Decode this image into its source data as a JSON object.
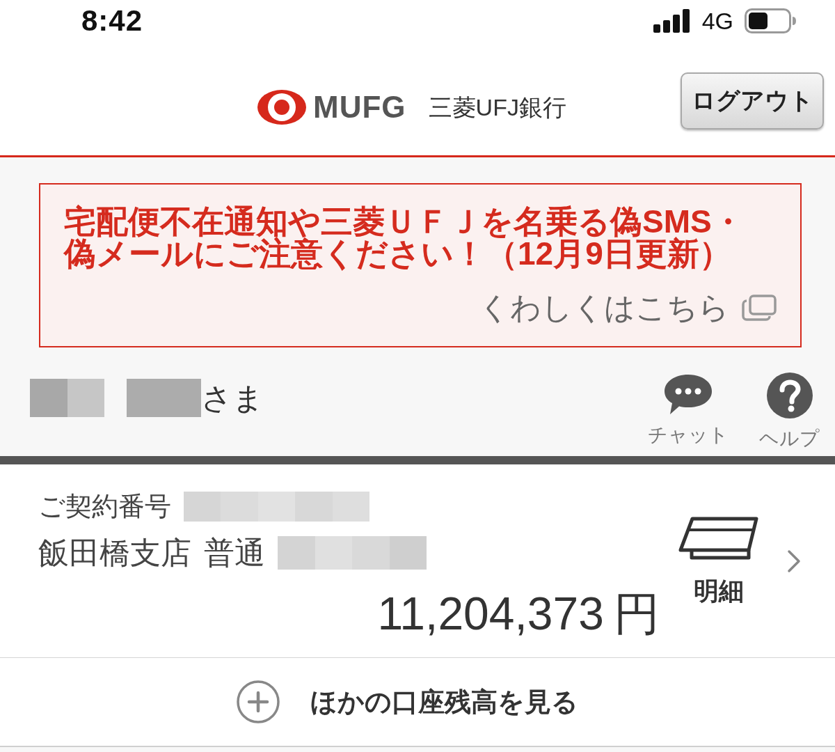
{
  "status_bar": {
    "time": "8:42",
    "network": "4G"
  },
  "header": {
    "logo_text": "MUFG",
    "bank_name": "三菱UFJ銀行",
    "logout_button": "ログアウト"
  },
  "alert": {
    "message": "宅配便不在通知や三菱ＵＦＪを名乗る偽SMS・偽メールにご注意ください！（12月9日更新）",
    "link": "くわしくはこちら"
  },
  "user": {
    "suffix": "さま"
  },
  "quick_actions": [
    {
      "kind": "chat",
      "label": "チャット"
    },
    {
      "kind": "help",
      "label": "ヘルプ"
    }
  ],
  "account": {
    "contract_label": "ご契約番号",
    "branch": "飯田橋支店",
    "type": "普通",
    "balance": "11,204,373",
    "currency": "円",
    "statement_label": "明細"
  },
  "more_accounts": {
    "label": "ほかの口座残高を見る"
  }
}
